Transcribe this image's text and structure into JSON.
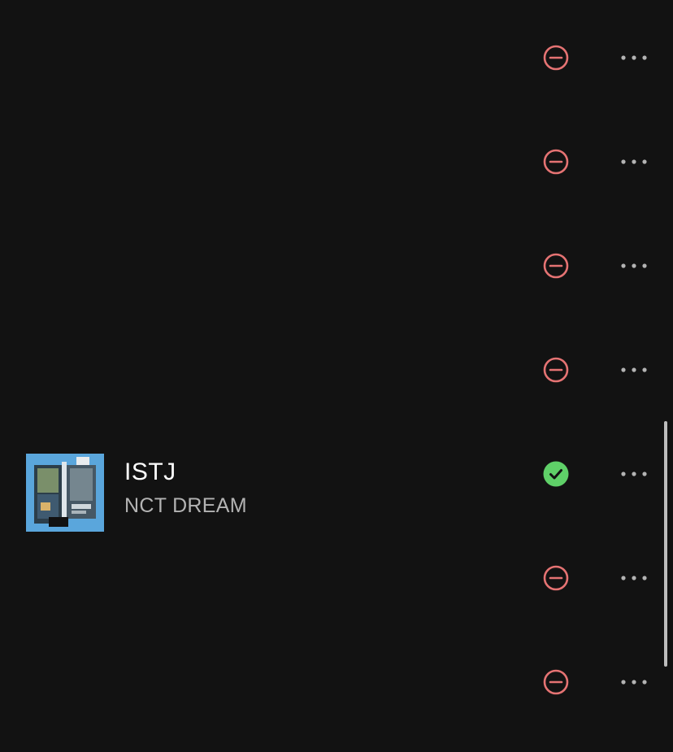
{
  "colors": {
    "background": "#121212",
    "excluded_icon": "#e57373",
    "included_icon": "#5fd068",
    "more_dots": "#b3b3b3",
    "artwork_bg": "#5aa6dc"
  },
  "rows": [
    {
      "status": "excluded",
      "status_icon": "minus-circle-icon",
      "more_icon": "more-horizontal-icon"
    },
    {
      "status": "excluded",
      "status_icon": "minus-circle-icon",
      "more_icon": "more-horizontal-icon"
    },
    {
      "status": "excluded",
      "status_icon": "minus-circle-icon",
      "more_icon": "more-horizontal-icon"
    },
    {
      "status": "excluded",
      "status_icon": "minus-circle-icon",
      "more_icon": "more-horizontal-icon"
    },
    {
      "status": "included",
      "status_icon": "check-circle-icon",
      "more_icon": "more-horizontal-icon",
      "title": "ISTJ",
      "artist": "NCT DREAM"
    },
    {
      "status": "excluded",
      "status_icon": "minus-circle-icon",
      "more_icon": "more-horizontal-icon"
    },
    {
      "status": "excluded",
      "status_icon": "minus-circle-icon",
      "more_icon": "more-horizontal-icon"
    }
  ]
}
